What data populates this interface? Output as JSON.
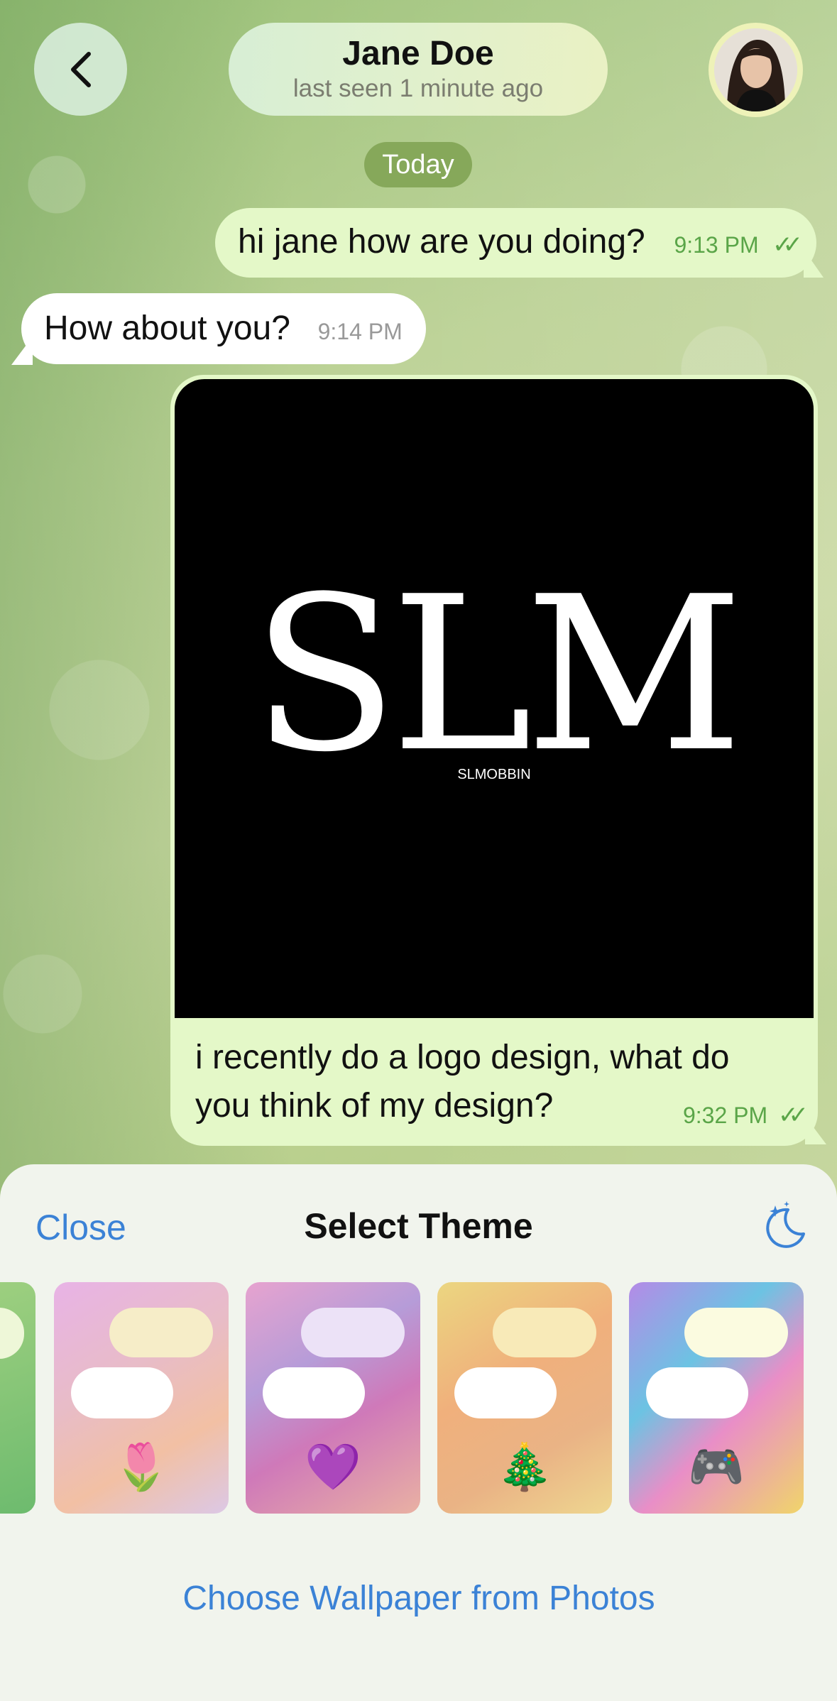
{
  "header": {
    "name": "Jane Doe",
    "status": "last seen 1 minute ago"
  },
  "icons": {
    "back": "chevron-left-icon",
    "moon": "moon-stars-icon",
    "ticks": "double-check-icon"
  },
  "date_separator": "Today",
  "messages": [
    {
      "direction": "out",
      "text": "hi jane how are you doing?",
      "time": "9:13 PM"
    },
    {
      "direction": "in",
      "text": "How about you?",
      "time": "9:14 PM"
    }
  ],
  "photo_message": {
    "logo_text": "SLM",
    "logo_subtext": "SLMOBBIN",
    "caption": "i recently do a logo design, what do you think of my design?",
    "time": "9:32 PM"
  },
  "theme_sheet": {
    "close_label": "Close",
    "title": "Select Theme",
    "themes": [
      {
        "emoji": "🌷"
      },
      {
        "emoji": "💜"
      },
      {
        "emoji": "🎄"
      },
      {
        "emoji": "🎮"
      }
    ],
    "choose_wallpaper_label": "Choose Wallpaper from Photos"
  },
  "colors": {
    "accent": "#3b82d6",
    "outgoing_bubble": "#e4f8c8",
    "incoming_bubble": "#ffffff",
    "read_tick": "#5aa548"
  }
}
